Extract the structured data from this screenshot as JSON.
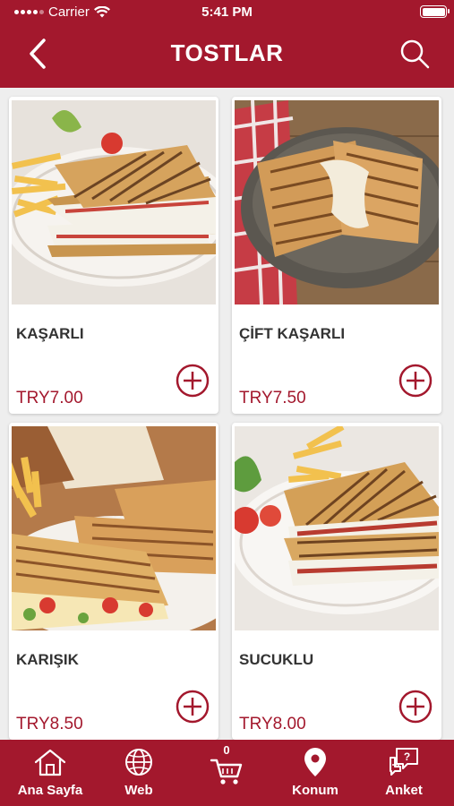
{
  "status_bar": {
    "carrier": "Carrier",
    "time": "5:41 PM"
  },
  "header": {
    "title": "TOSTLAR",
    "back_icon": "chevron-left-icon",
    "search_icon": "search-icon"
  },
  "colors": {
    "brand": "#a3182d",
    "card_bg": "#ffffff",
    "page_bg": "#eeeeee"
  },
  "products": [
    {
      "name": "KAŞARLI",
      "price": "TRY7.00"
    },
    {
      "name": "ÇİFT KAŞARLI",
      "price": "TRY7.50"
    },
    {
      "name": "KARIŞIK",
      "price": "TRY8.50"
    },
    {
      "name": "SUCUKLU",
      "price": "TRY8.00"
    }
  ],
  "tabbar": {
    "home": "Ana Sayfa",
    "web": "Web",
    "cart_count": "0",
    "location": "Konum",
    "survey": "Anket"
  }
}
